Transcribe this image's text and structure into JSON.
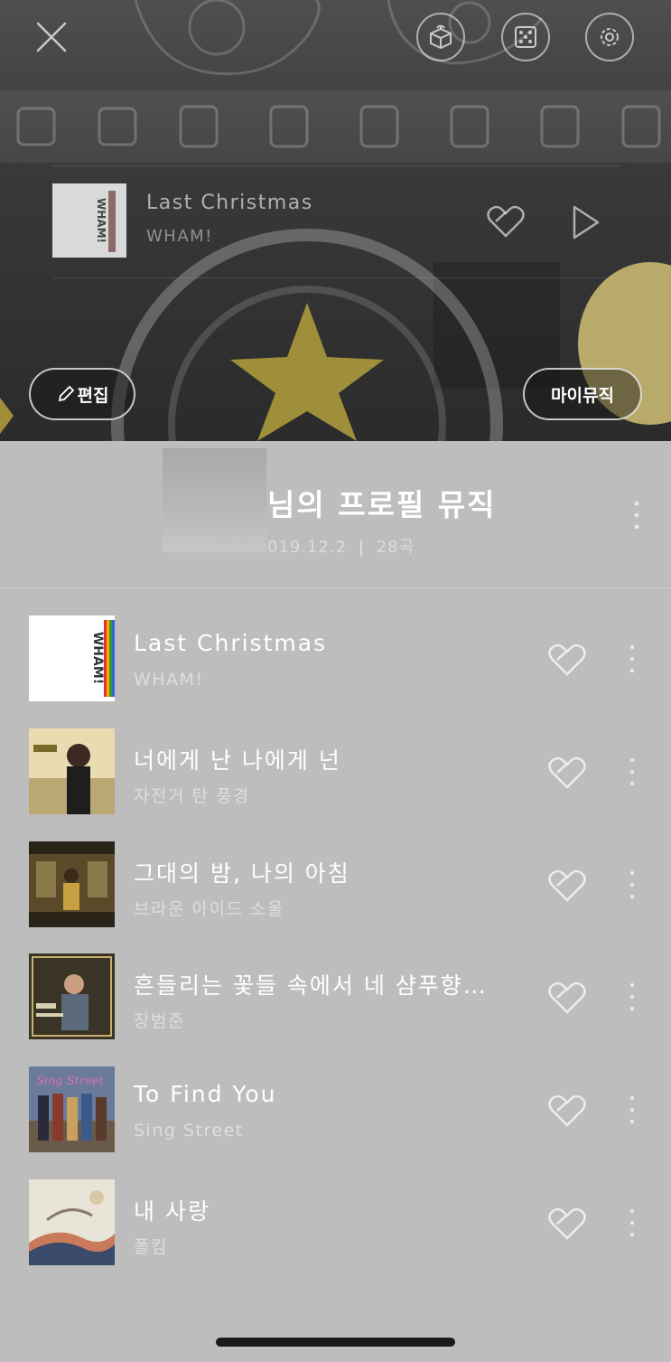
{
  "header": {
    "close_icon": "close-icon",
    "buttons": [
      "gift-box-icon",
      "dice-icon",
      "gear-icon"
    ],
    "now_playing": {
      "title": "Last Christmas",
      "artist": "WHAM!",
      "cover_text": "WHAM!"
    },
    "edit_label": "편집",
    "my_music_label": "마이뮤직"
  },
  "playlist": {
    "title": "님의 프로필 뮤직",
    "date": "019.12.2",
    "separator": "|",
    "count": "28곡"
  },
  "songs": [
    {
      "title": "Last Christmas",
      "artist": "WHAM!",
      "cover_text": "WHAM!"
    },
    {
      "title": "너에게 난 나에게 넌",
      "artist": "자전거 탄 풍경"
    },
    {
      "title": "그대의 밤, 나의 아침",
      "artist": "브라운 아이드 소울"
    },
    {
      "title": "흔들리는 꽃들 속에서 네 샴푸향…",
      "artist": "장범준"
    },
    {
      "title": "To Find You",
      "artist": "Sing Street",
      "cover_text": "Sing Street"
    },
    {
      "title": "내 사랑",
      "artist": "폴킴"
    }
  ],
  "colors": {
    "overlay_gray": "#bdbdbd",
    "header_dark": "#3a3a3a",
    "text_white": "#ffffff"
  }
}
